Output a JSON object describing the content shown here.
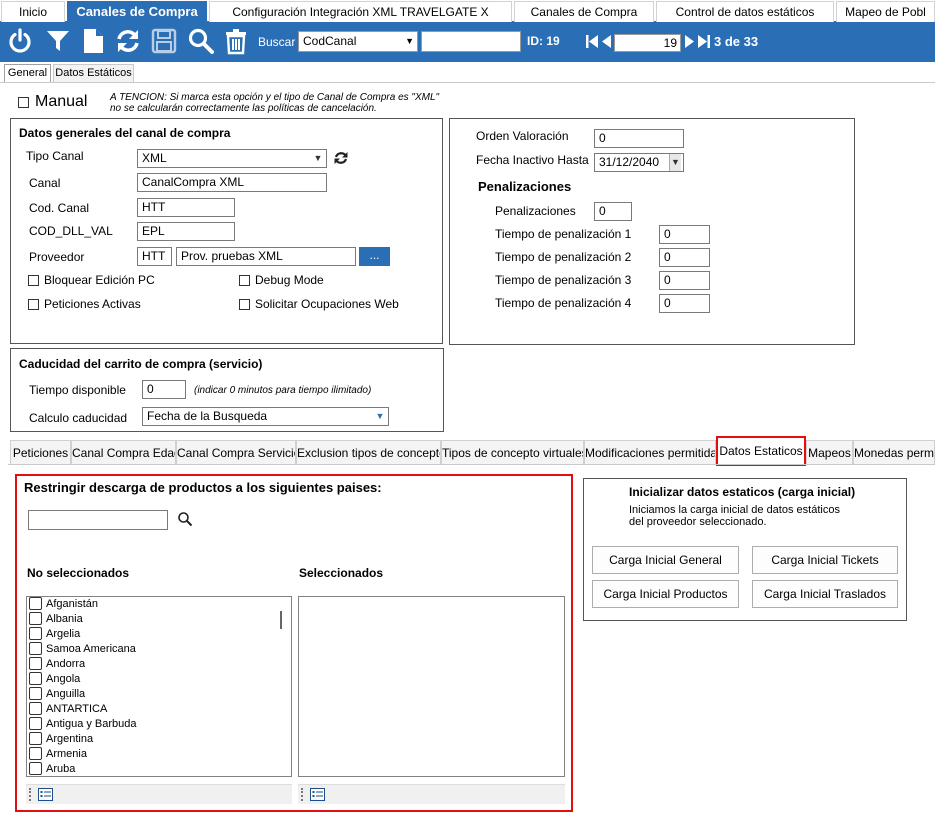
{
  "top_tabs": [
    "Inicio",
    "Canales de Compra",
    "Configuración Integración XML TRAVELGATE X",
    "Canales de Compra",
    "Control de datos estáticos",
    "Mapeo de Pobl"
  ],
  "toolbar": {
    "buscar_label": "Buscar",
    "search_field": "CodCanal",
    "id_text": "ID: 19",
    "record_number": "19",
    "record_count": "3 de 33",
    "icons": [
      "power-icon",
      "filter-icon",
      "new-document-icon",
      "refresh-icon",
      "save-icon",
      "search-icon",
      "delete-icon"
    ]
  },
  "sub_tabs": [
    "General",
    "Datos Estáticos"
  ],
  "manual": {
    "label": "Manual",
    "note_line1": "A TENCION: Si marca esta opción y el tipo de Canal de Compra es \"XML\"",
    "note_line2": "no se calcularán correctamente las políticas de cancelación."
  },
  "datos_generales": {
    "title": "Datos generales del canal de compra",
    "tipo_canal_label": "Tipo Canal",
    "tipo_canal_value": "XML",
    "canal_label": "Canal",
    "canal_value": "CanalCompra XML",
    "cod_canal_label": "Cod. Canal",
    "cod_canal_value": "HTT",
    "cod_dll_label": "COD_DLL_VAL",
    "cod_dll_value": "EPL",
    "proveedor_label": "Proveedor",
    "proveedor_code": "HTT",
    "proveedor_name": "Prov. pruebas XML",
    "browse_label": "...",
    "checks": {
      "bloquear": "Bloquear Edición PC",
      "debug": "Debug Mode",
      "peticiones": "Peticiones Activas",
      "solicitar": "Solicitar Ocupaciones Web"
    }
  },
  "right_panel": {
    "orden_label": "Orden Valoración",
    "orden_value": "0",
    "fecha_label": "Fecha Inactivo Hasta",
    "fecha_value": "31/12/2040",
    "penalizaciones_title": "Penalizaciones",
    "penalizaciones_label": "Penalizaciones",
    "penalizaciones_value": "0",
    "tiempos": [
      {
        "label": "Tiempo de penalización 1",
        "value": "0"
      },
      {
        "label": "Tiempo de penalización 2",
        "value": "0"
      },
      {
        "label": "Tiempo de penalización 3",
        "value": "0"
      },
      {
        "label": "Tiempo de penalización 4",
        "value": "0"
      }
    ]
  },
  "caducidad": {
    "title": "Caducidad del carrito de compra (servicio)",
    "tiempo_label": "Tiempo disponible",
    "tiempo_value": "0",
    "tiempo_hint": "(indicar 0 minutos para tiempo ilimitado)",
    "calculo_label": "Calculo caducidad",
    "calculo_value": "Fecha de la Busqueda"
  },
  "lower_tabs": [
    "Peticiones",
    "Canal Compra Edad",
    "Canal Compra Servicio",
    "Exclusion tipos de concepto",
    "Tipos de concepto virtuales",
    "Modificaciones permitidas",
    "Datos Estaticos",
    "Mapeos",
    "Monedas permiti"
  ],
  "restringir": {
    "title": "Restringir descarga de productos a los siguientes paises:",
    "search_value": "",
    "no_seleccionados_label": "No seleccionados",
    "seleccionados_label": "Seleccionados",
    "countries": [
      "Afganistán",
      "Albania",
      "Argelia",
      "Samoa Americana",
      "Andorra",
      "Angola",
      "Anguilla",
      "ANTARTICA",
      "Antigua y Barbuda",
      "Argentina",
      "Armenia",
      "Aruba"
    ]
  },
  "inicializar": {
    "title": "Inicializar datos estaticos (carga inicial)",
    "desc_line1": "Iniciamos la carga inicial de datos estáticos",
    "desc_line2": "del proveedor seleccionado.",
    "btn_general": "Carga Inicial General",
    "btn_tickets": "Carga Inicial Tickets",
    "btn_productos": "Carga Inicial Productos",
    "btn_traslados": "Carga Inicial Traslados"
  },
  "colors": {
    "toolbar_blue": "#2a6fb5",
    "highlight_red": "#e01010"
  }
}
